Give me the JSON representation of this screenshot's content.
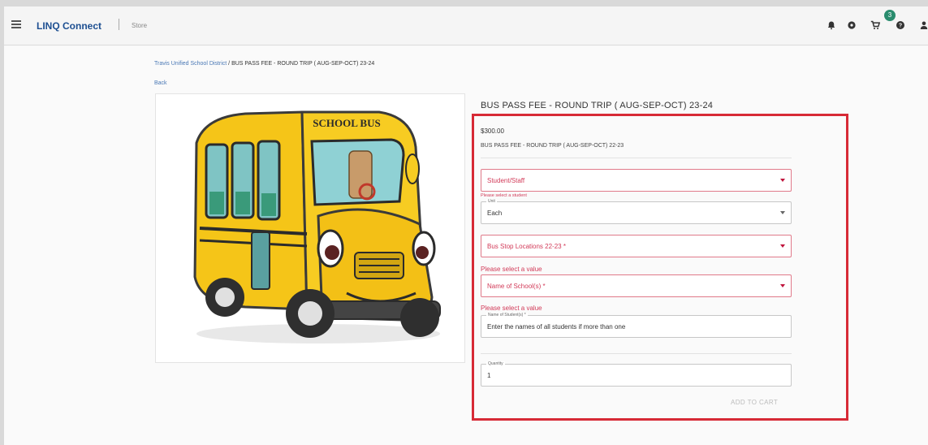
{
  "app": {
    "brand": "LINQ Connect",
    "section": "Store",
    "cart_count": "3"
  },
  "icons": [
    "menu-icon",
    "bell-icon",
    "settings-icon",
    "cart-icon",
    "help-icon",
    "user-icon"
  ],
  "colors": {
    "brand": "#1d4f91",
    "badge": "#2a8c6e",
    "error": "#d23a58",
    "highlight": "#d72a36"
  },
  "breadcrumb": {
    "parent": "Travis Unified School District",
    "current": "BUS PASS FEE - ROUND TRIP ( AUG-SEP-OCT) 23-24"
  },
  "back_label": "Back",
  "product": {
    "title": "BUS PASS FEE - ROUND TRIP ( AUG-SEP-OCT) 23-24",
    "price": "$300.00",
    "description": "BUS PASS FEE - ROUND TRIP ( AUG-SEP-OCT) 22-23",
    "image_label": "SCHOOL BUS"
  },
  "form": {
    "student": {
      "placeholder": "Student/Staff",
      "error": "Please select a student"
    },
    "unit": {
      "label": "Unit",
      "value": "Each"
    },
    "bus_stop": {
      "placeholder": "Bus Stop Locations 22-23 *",
      "error": "Please select a value"
    },
    "school": {
      "placeholder": "Name of School(s) *",
      "error": "Please select a value"
    },
    "student_names": {
      "label": "Name of Student(s) *",
      "value": "Enter the names of all students if more than one"
    },
    "quantity": {
      "label": "Quantity",
      "value": "1"
    },
    "add_to_cart": "ADD TO CART"
  }
}
